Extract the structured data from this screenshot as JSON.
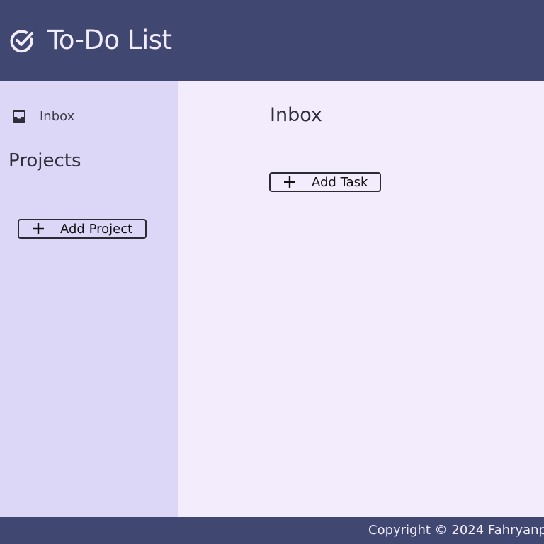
{
  "header": {
    "title": "To-Do List",
    "logo_icon": "check-circle-icon"
  },
  "sidebar": {
    "inbox": {
      "label": "Inbox",
      "icon": "inbox-icon"
    },
    "projects_heading": "Projects",
    "add_project_label": "Add Project"
  },
  "main": {
    "title": "Inbox",
    "add_task_label": "Add Task"
  },
  "footer": {
    "copyright": "Copyright © 2024 Fahryanp"
  },
  "colors": {
    "header_bg": "#404872",
    "sidebar_bg": "#dcd6f7",
    "main_bg": "#f3ecfd",
    "text": "#2e2e3a"
  }
}
